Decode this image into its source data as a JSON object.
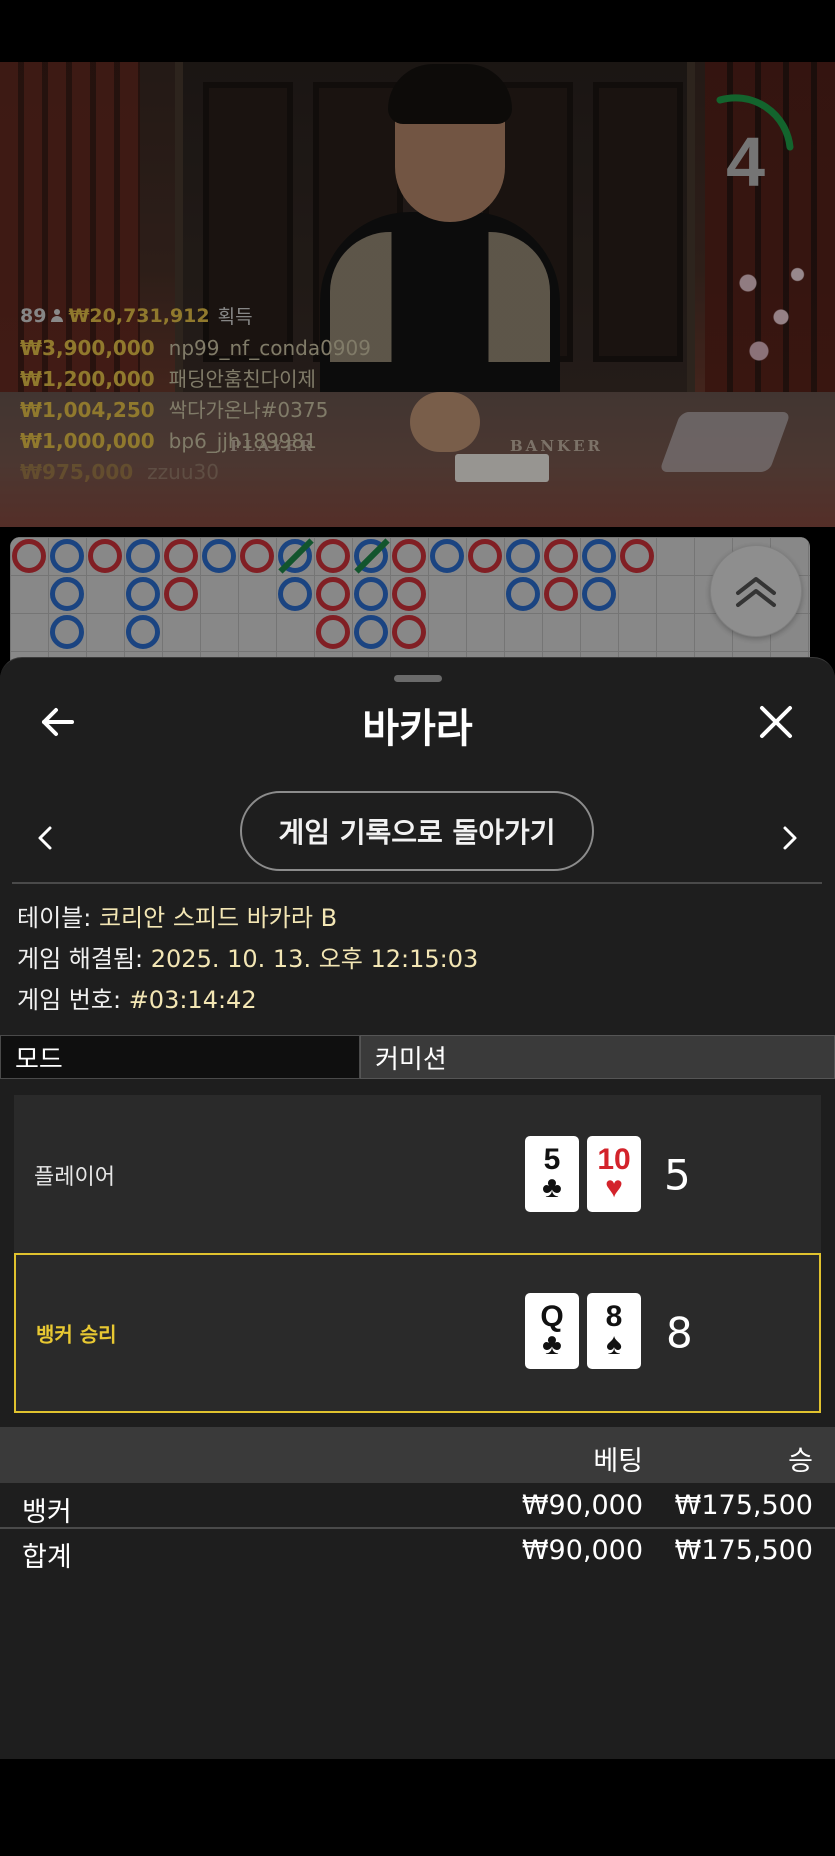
{
  "video": {
    "timer": "4",
    "table_text_left": "PLAYER",
    "table_text_right": "BANKER",
    "winners": {
      "count": "89",
      "total": "₩20,731,912",
      "label": "획득",
      "rows": [
        {
          "amount": "₩3,900,000",
          "name": "np99_nf_conda0909"
        },
        {
          "amount": "₩1,200,000",
          "name": "패딩안훔친다이제"
        },
        {
          "amount": "₩1,004,250",
          "name": "싹다가온나#0375"
        },
        {
          "amount": "₩1,000,000",
          "name": "bp6_jjh189981"
        },
        {
          "amount": "₩975,000",
          "name": "zzuu30"
        }
      ]
    }
  },
  "sheet": {
    "title": "바카라",
    "back_label": "게임 기록으로 돌아가기",
    "info": {
      "table_label": "테이블:",
      "table_value": "코리안 스피드 바카라 B",
      "resolved_label": "게임 해결됨:",
      "resolved_value": "2025. 10. 13. 오후 12:15:03",
      "number_label": "게임 번호:",
      "number_value": "#03:14:42"
    },
    "tabs": [
      {
        "label": "모드"
      },
      {
        "label": "커미션"
      }
    ],
    "hands": {
      "player": {
        "label": "플레이어",
        "cards": [
          {
            "rank": "5",
            "suit": "♣",
            "color": "black"
          },
          {
            "rank": "10",
            "suit": "♥",
            "color": "red"
          }
        ],
        "score": "5"
      },
      "banker": {
        "label": "뱅커 승리",
        "cards": [
          {
            "rank": "Q",
            "suit": "♣",
            "color": "black"
          },
          {
            "rank": "8",
            "suit": "♠",
            "color": "black"
          }
        ],
        "score": "8"
      }
    },
    "bets": {
      "header_bet": "베팅",
      "header_win": "승",
      "rows": [
        {
          "label": "뱅커",
          "bet": "₩90,000",
          "win": "₩175,500"
        },
        {
          "label": "합계",
          "bet": "₩90,000",
          "win": "₩175,500"
        }
      ]
    }
  },
  "colors": {
    "accent_gold": "#e8c832",
    "banker_red": "#d1333a",
    "player_blue": "#2c6fd1",
    "tie_green": "#1e8a4a"
  }
}
